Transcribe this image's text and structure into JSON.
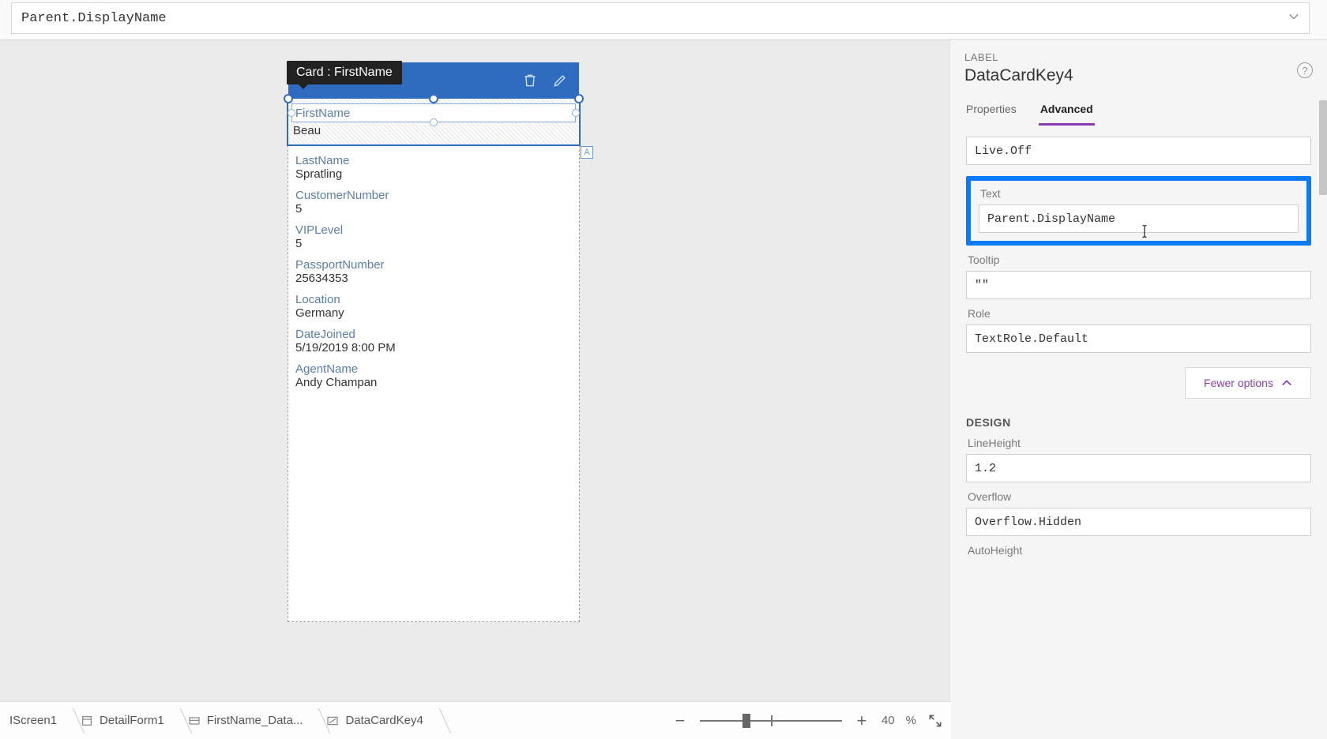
{
  "formula_bar": {
    "value": "Parent.DisplayName"
  },
  "canvas": {
    "card_tooltip": "Card : FirstName",
    "selection_badge": "A",
    "selected_card": {
      "label": "FirstName",
      "value": "Beau"
    },
    "fields": [
      {
        "label": "LastName",
        "value": "Spratling"
      },
      {
        "label": "CustomerNumber",
        "value": "5"
      },
      {
        "label": "VIPLevel",
        "value": "5"
      },
      {
        "label": "PassportNumber",
        "value": "25634353"
      },
      {
        "label": "Location",
        "value": "Germany"
      },
      {
        "label": "DateJoined",
        "value": "5/19/2019 8:00 PM"
      },
      {
        "label": "AgentName",
        "value": "Andy Champan"
      }
    ]
  },
  "right_panel": {
    "over": "LABEL",
    "title": "DataCardKey4",
    "tabs": {
      "properties": "Properties",
      "advanced": "Advanced"
    },
    "props": {
      "live_value": "Live.Off",
      "text_label": "Text",
      "text_value": "Parent.DisplayName",
      "tooltip_label": "Tooltip",
      "tooltip_value": "\"\"",
      "role_label": "Role",
      "role_value": "TextRole.Default",
      "fewer": "Fewer options",
      "design": "DESIGN",
      "lineheight_label": "LineHeight",
      "lineheight_value": "1.2",
      "overflow_label": "Overflow",
      "overflow_value": "Overflow.Hidden",
      "autoheight_label": "AutoHeight"
    }
  },
  "status": {
    "crumbs": [
      {
        "label": "IScreen1"
      },
      {
        "label": "DetailForm1"
      },
      {
        "label": "FirstName_Data..."
      },
      {
        "label": "DataCardKey4"
      }
    ],
    "zoom": {
      "percent": "40",
      "pct_sign": "%"
    }
  }
}
